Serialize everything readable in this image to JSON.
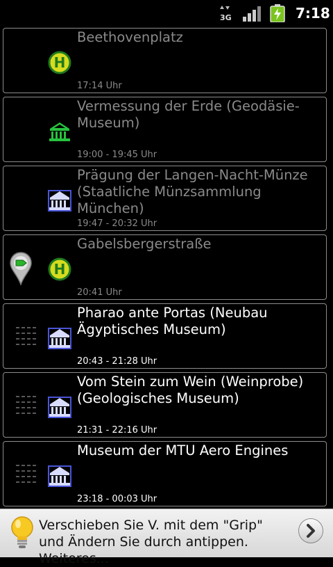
{
  "status_bar": {
    "network_label": "3G",
    "time": "7:18",
    "icons": [
      "data-3g-icon",
      "signal-icon",
      "battery-charging-icon"
    ]
  },
  "stops": [
    {
      "title": "Beethovenplatz",
      "time": "17:14 Uhr",
      "type_icon": "bus-stop-icon",
      "active": false,
      "marker": "none"
    },
    {
      "title": "Vermessung der Erde (Geodäsie-Museum)",
      "time": "19:00 - 19:45 Uhr",
      "type_icon": "museum-icon-green",
      "active": false,
      "marker": "none"
    },
    {
      "title": "Prägung der Langen-Nacht-Münze (Staatliche Münzsammlung München)",
      "time": "19:47 - 20:32 Uhr",
      "type_icon": "museum-icon-blue",
      "active": false,
      "marker": "none"
    },
    {
      "title": "Gabelsbergerstraße",
      "time": "20:41 Uhr",
      "type_icon": "bus-stop-icon",
      "active": false,
      "marker": "location-pin"
    },
    {
      "title": "Pharao ante Portas (Neubau Ägyptisches Museum)",
      "time": "20:43 - 21:28 Uhr",
      "type_icon": "museum-icon-blue",
      "active": true,
      "marker": "grip"
    },
    {
      "title": "Vom Stein zum Wein (Weinprobe) (Geologisches Museum)",
      "time": "21:31 - 22:16 Uhr",
      "type_icon": "museum-icon-blue",
      "active": true,
      "marker": "grip"
    },
    {
      "title": "Museum der MTU Aero Engines",
      "time": "23:18 - 00:03 Uhr",
      "type_icon": "museum-icon-blue",
      "active": true,
      "marker": "grip"
    }
  ],
  "hint": {
    "text": "Verschieben Sie V. mit dem \"Grip\" und Ändern Sie durch antippen. Weiteres...",
    "icon": "lightbulb-icon",
    "button_icon": "chevron-right-icon"
  },
  "colors": {
    "bus_stop": "#d6dc1e",
    "museum_green": "#27c23f",
    "museum_blue": "#4a55d9",
    "inactive_text": "#8a8a8a",
    "active_text": "#ffffff"
  }
}
